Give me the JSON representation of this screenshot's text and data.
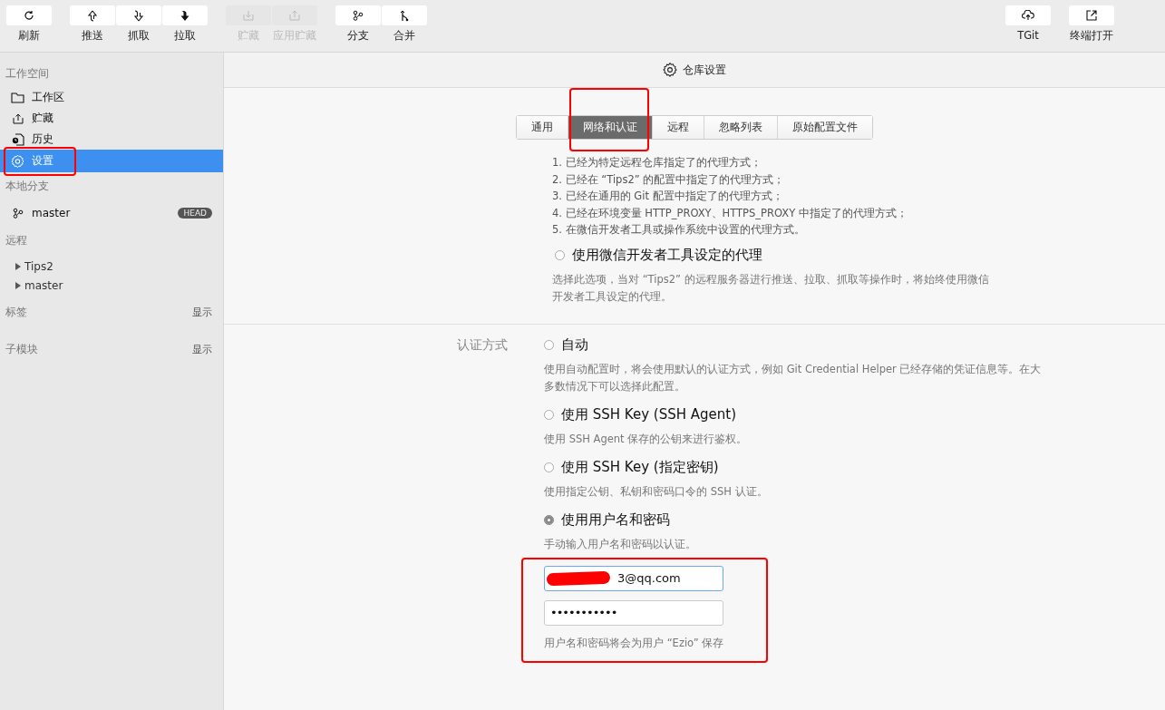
{
  "toolbar": {
    "left": [
      {
        "buttons": [
          {
            "label": "刷新",
            "disabled": false
          }
        ]
      },
      {
        "buttons": [
          {
            "label": "推送",
            "disabled": false
          },
          {
            "label": "抓取",
            "disabled": false
          },
          {
            "label": "拉取",
            "disabled": false
          }
        ]
      },
      {
        "buttons": [
          {
            "label": "贮藏",
            "disabled": true
          },
          {
            "label": "应用贮藏",
            "disabled": true
          }
        ]
      },
      {
        "buttons": [
          {
            "label": "分支",
            "disabled": false
          },
          {
            "label": "合并",
            "disabled": false
          }
        ]
      }
    ],
    "right": [
      {
        "buttons": [
          {
            "label": "TGit",
            "disabled": false
          }
        ]
      },
      {
        "buttons": [
          {
            "label": "终端打开",
            "disabled": false
          }
        ]
      }
    ]
  },
  "sidebar": {
    "sections": [
      {
        "title": "工作空间",
        "items": [
          {
            "kind": "nav",
            "label": "工作区",
            "selected": false,
            "highlighted": false
          },
          {
            "kind": "nav",
            "label": "贮藏",
            "selected": false,
            "highlighted": false
          },
          {
            "kind": "nav",
            "label": "历史",
            "selected": false,
            "highlighted": false
          },
          {
            "kind": "nav",
            "label": "设置",
            "selected": true,
            "highlighted": true
          }
        ]
      },
      {
        "title": "本地分支",
        "items": [
          {
            "kind": "branch",
            "label": "master",
            "badge": "HEAD"
          }
        ]
      },
      {
        "title": "远程",
        "items": [
          {
            "kind": "remote",
            "label": "Tips2"
          },
          {
            "kind": "remote",
            "label": "master"
          }
        ]
      },
      {
        "title": "标签",
        "action": "显示"
      },
      {
        "title": "子模块",
        "action": "显示"
      }
    ]
  },
  "main": {
    "title": "仓库设置",
    "tabs": [
      {
        "label": "通用",
        "selected": false,
        "highlighted": false
      },
      {
        "label": "网络和认证",
        "selected": true,
        "highlighted": true
      },
      {
        "label": "远程",
        "selected": false,
        "highlighted": false
      },
      {
        "label": "忽略列表",
        "selected": false,
        "highlighted": false
      },
      {
        "label": "原始配置文件",
        "selected": false,
        "highlighted": false
      }
    ],
    "proxy": {
      "lines": [
        "1. 已经为特定远程仓库指定了的代理方式；",
        "2. 已经在 “Tips2” 的配置中指定了的代理方式；",
        "3. 已经在通用的 Git 配置中指定了的代理方式；",
        "4. 已经在环境变量 HTTP_PROXY、HTTPS_PROXY 中指定了的代理方式；",
        "5. 在微信开发者工具或操作系统中设置的代理方式。"
      ],
      "option": {
        "label": "使用微信开发者工具设定的代理",
        "selected": false,
        "description": "选择此选项，当对 “Tips2” 的远程服务器进行推送、拉取、抓取等操作时，将始终使用微信开发者工具设定的代理。"
      }
    },
    "auth": {
      "label": "认证方式",
      "options": [
        {
          "label": "自动",
          "selected": false,
          "description": "使用自动配置时，将会使用默认的认证方式，例如 Git Credential Helper 已经存储的凭证信息等。在大多数情况下可以选择此配置。"
        },
        {
          "label": "使用 SSH Key (SSH Agent)",
          "selected": false,
          "description": "使用 SSH Agent 保存的公钥来进行鉴权。"
        },
        {
          "label": "使用 SSH Key (指定密钥)",
          "selected": false,
          "description": "使用指定公钥、私钥和密码口令的 SSH 认证。"
        },
        {
          "label": "使用用户名和密码",
          "selected": true,
          "description": "手动输入用户名和密码以认证。"
        }
      ],
      "credentials": {
        "highlighted": true,
        "username": {
          "value": "3@qq.com",
          "redacted": true,
          "focused": true
        },
        "password": {
          "value": "•••••••••••"
        },
        "note": "用户名和密码将会为用户 “Ezio” 保存"
      }
    }
  }
}
